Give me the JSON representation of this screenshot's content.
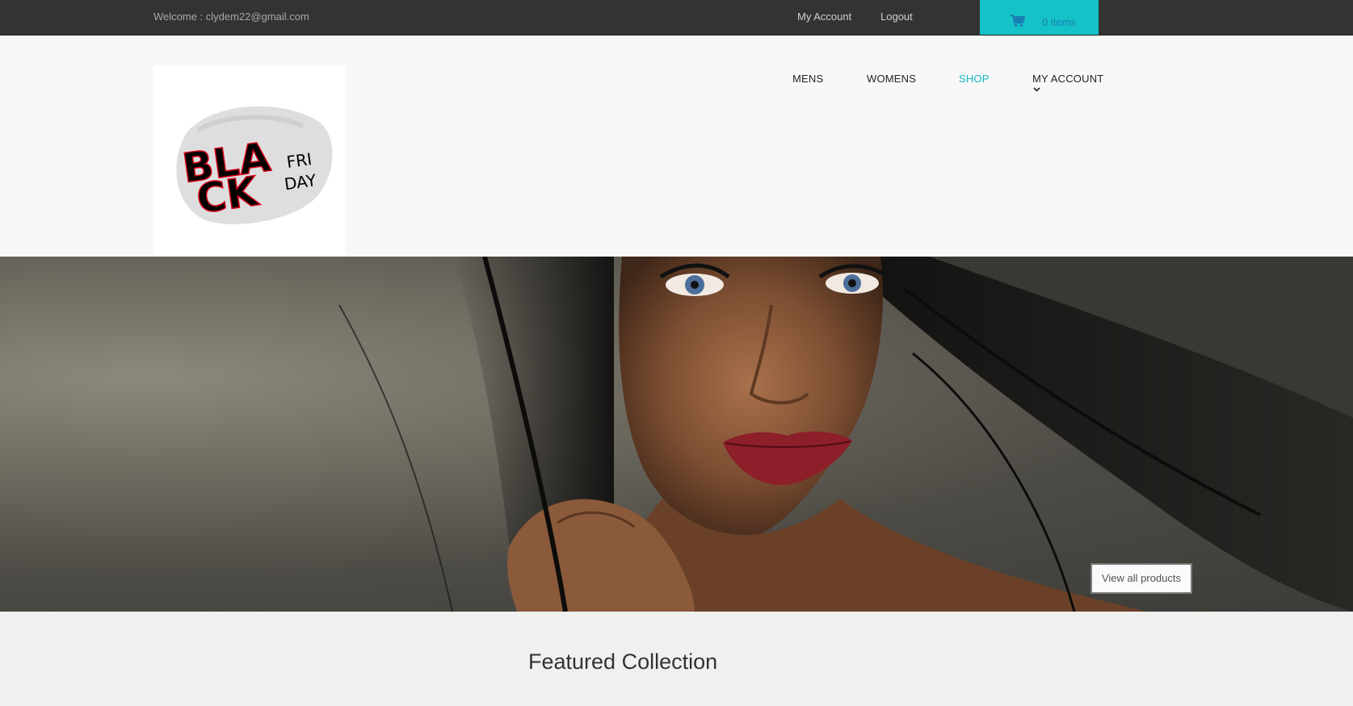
{
  "topbar": {
    "welcome_text": "Welcome : clydem22@gmail.com",
    "my_account_label": "My Account",
    "logout_label": "Logout",
    "cart_label": "0 items",
    "cart_icon": "shopping-cart-icon"
  },
  "logo": {
    "line1": "BLA",
    "line2": "CK",
    "fri": "FRI",
    "day": "DAY"
  },
  "nav": {
    "items": [
      {
        "label": "MENS"
      },
      {
        "label": "WOMENS"
      },
      {
        "label": "SHOP"
      },
      {
        "label": "MY ACCOUNT"
      }
    ],
    "active": "SHOP",
    "dropdown_icon": "chevron-down-icon"
  },
  "hero": {
    "button_label": "View all products"
  },
  "featured": {
    "title": "Featured Collection"
  },
  "colors": {
    "accent": "#14c2c7",
    "topbar_bg": "#333333",
    "header_bg": "#f8f8f8"
  }
}
